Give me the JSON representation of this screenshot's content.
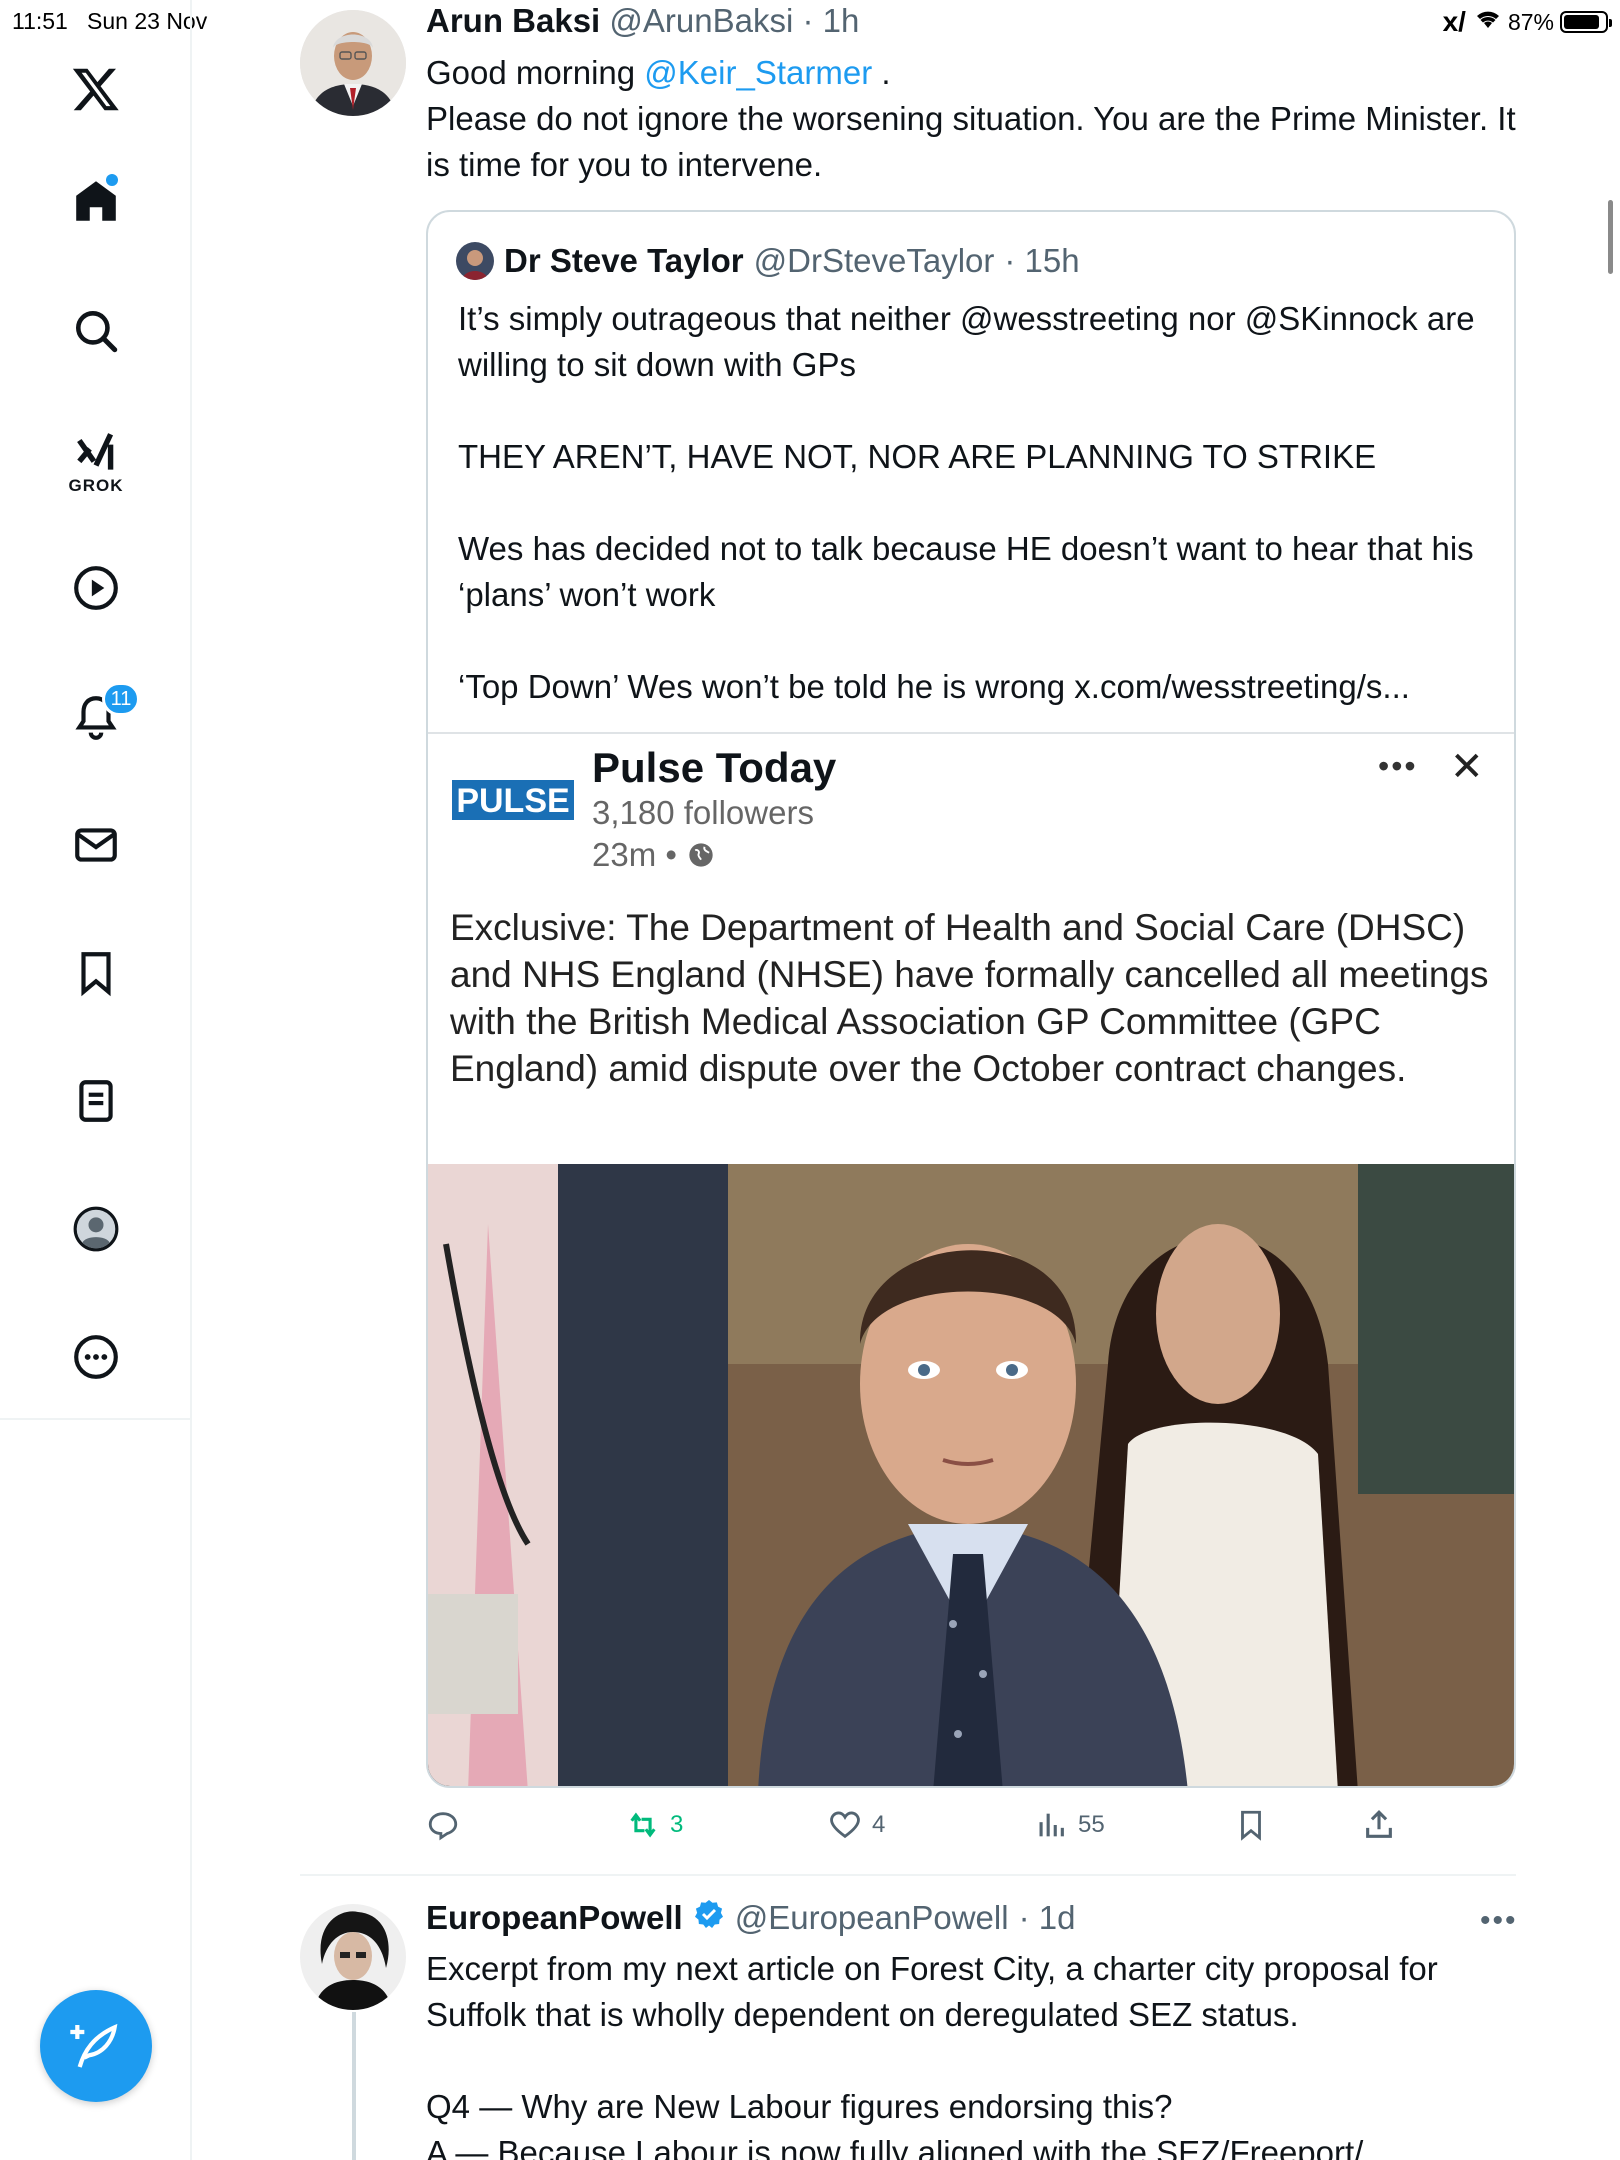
{
  "status_bar": {
    "time": "11:51",
    "date": "Sun 23 Nov",
    "battery": "87%",
    "battery_level": 0.87
  },
  "sidebar": {
    "items": [
      {
        "name": "x-logo-icon"
      },
      {
        "name": "home-icon",
        "has_dot": true
      },
      {
        "name": "search-icon"
      },
      {
        "name": "grok-icon",
        "label": "GROK"
      },
      {
        "name": "video-icon"
      },
      {
        "name": "notifications-icon",
        "badge": "11"
      },
      {
        "name": "messages-icon"
      },
      {
        "name": "bookmarks-icon"
      },
      {
        "name": "lists-icon"
      },
      {
        "name": "profile-icon"
      },
      {
        "name": "more-icon"
      }
    ],
    "accent": "#1d9bf0"
  },
  "tweet1": {
    "name": "Arun Baksi",
    "handle": "@ArunBaksi",
    "time": "· 1h",
    "body_prefix": "Good morning ",
    "mention": "@Keir_Starmer",
    "body_mention_suffix": " .",
    "body_rest": "Please do not ignore the worsening situation. You are the Prime Minister. It is time for you to intervene.",
    "quote": {
      "name": "Dr Steve Taylor",
      "handle": "@DrSteveTaylor",
      "time": "· 15h",
      "paragraphs": [
        "It’s simply outrageous that neither @wesstreeting nor @SKinnock are willing to sit down with GPs",
        "THEY AREN’T, HAVE NOT, NOR ARE PLANNING TO STRIKE",
        "Wes has decided not to talk because HE doesn’t want to hear that his ‘plans’ won’t work",
        "‘Top Down’ Wes won’t be told he is wrong x.com/wesstreeting/s..."
      ],
      "embed": {
        "logo_text": "PULSE",
        "name": "Pulse Today",
        "followers": "3,180 followers",
        "time": "23m •",
        "more": "•••",
        "close": "✕",
        "text": "Exclusive: The Department of Health and Social Care (DHSC) and NHS England (NHSE) have formally cancelled all meetings with the British Medical Association GP Committee (GPC England) amid dispute over the October contract changes."
      }
    },
    "actions": {
      "replies": "",
      "reposts": "3",
      "likes": "4",
      "views": "55"
    }
  },
  "tweet2": {
    "name": "EuropeanPowell",
    "handle": "@EuropeanPowell",
    "time": "· 1d",
    "more": "•••",
    "paragraphs": [
      "Excerpt from my next article on Forest City, a charter city proposal for Suffolk that is wholly dependent on deregulated SEZ status.",
      "Q4 — Why are New Labour figures endorsing this?\nA — Because Labour is now fully aligned with the SEZ/Freeport/"
    ]
  },
  "colors": {
    "link": "#1d9bf0",
    "repost_green": "#00ba7c",
    "muted": "#536471",
    "border": "#cfd9de"
  }
}
